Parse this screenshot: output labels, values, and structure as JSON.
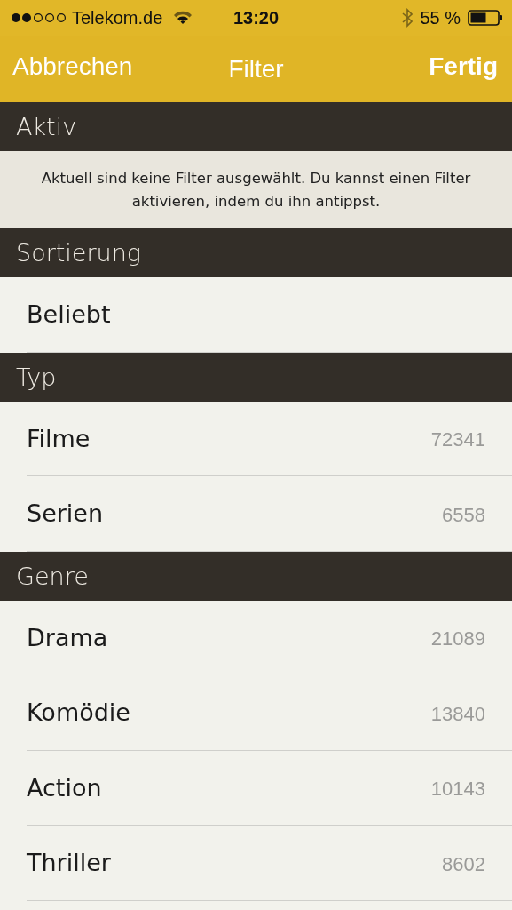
{
  "status_bar": {
    "carrier": "Telekom.de",
    "time": "13:20",
    "battery": "55 %"
  },
  "nav": {
    "cancel": "Abbrechen",
    "title": "Filter",
    "done": "Fertig"
  },
  "sections": [
    {
      "title": "Aktiv",
      "kind": "notice",
      "text": "Aktuell sind keine Filter ausgewählt. Du kannst einen Filter aktivieren, indem du ihn antippst."
    },
    {
      "title": "Sortierung",
      "kind": "list",
      "rows": [
        {
          "label": "Beliebt"
        }
      ]
    },
    {
      "title": "Typ",
      "kind": "list",
      "rows": [
        {
          "label": "Filme",
          "count": "72341"
        },
        {
          "label": "Serien",
          "count": "6558"
        }
      ]
    },
    {
      "title": "Genre",
      "kind": "list",
      "rows": [
        {
          "label": "Drama",
          "count": "21089"
        },
        {
          "label": "Komödie",
          "count": "13840"
        },
        {
          "label": "Action",
          "count": "10143"
        },
        {
          "label": "Thriller",
          "count": "8602"
        }
      ]
    }
  ]
}
